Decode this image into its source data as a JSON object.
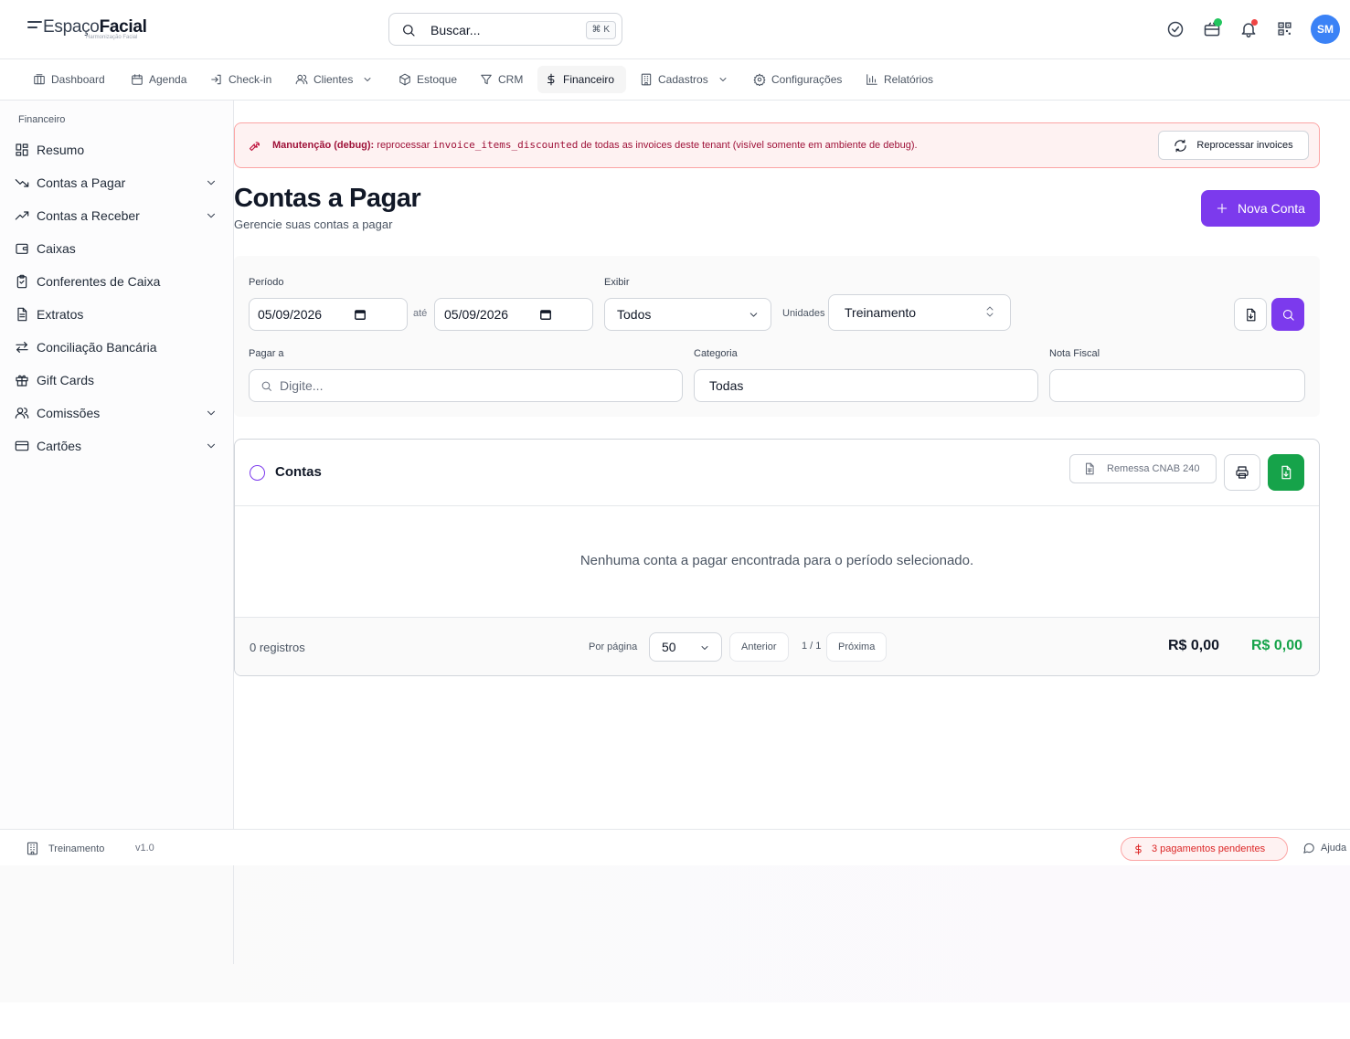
{
  "brand": {
    "name_light": "Espaço",
    "name_bold": "Facial",
    "tagline": "Harmonização Facial"
  },
  "search": {
    "placeholder": "Buscar...",
    "shortcut": "⌘ K"
  },
  "header": {
    "icons": [
      "check-circle-icon",
      "gift-card-icon",
      "bell-icon",
      "qr-code-icon"
    ],
    "avatar_initials": "SM",
    "colors": {
      "avatar": "#3b82f6",
      "status_green": "#22c55e",
      "status_red": "#ef4444"
    }
  },
  "nav": {
    "items": [
      {
        "label": "Dashboard",
        "icon": "dashboard-icon"
      },
      {
        "label": "Agenda",
        "icon": "calendar-icon"
      },
      {
        "label": "Check-in",
        "icon": "login-icon"
      },
      {
        "label": "Clientes",
        "icon": "users-icon",
        "dropdown": true
      },
      {
        "label": "Estoque",
        "icon": "box-icon"
      },
      {
        "label": "CRM",
        "icon": "filter-icon"
      },
      {
        "label": "Financeiro",
        "icon": "dollar-icon",
        "active": true
      },
      {
        "label": "Cadastros",
        "icon": "building-icon",
        "dropdown": true
      },
      {
        "label": "Configurações",
        "icon": "gear-icon"
      },
      {
        "label": "Relatórios",
        "icon": "bar-chart-icon"
      }
    ]
  },
  "sidebar": {
    "title": "Financeiro",
    "items": [
      {
        "label": "Resumo",
        "icon": "grid-icon"
      },
      {
        "label": "Contas a Pagar",
        "icon": "trending-down-icon",
        "expandable": true
      },
      {
        "label": "Contas a Receber",
        "icon": "trending-up-icon",
        "expandable": true
      },
      {
        "label": "Caixas",
        "icon": "wallet-icon"
      },
      {
        "label": "Conferentes de Caixa",
        "icon": "clipboard-check-icon"
      },
      {
        "label": "Extratos",
        "icon": "file-text-icon"
      },
      {
        "label": "Conciliação Bancária",
        "icon": "arrows-swap-icon"
      },
      {
        "label": "Gift Cards",
        "icon": "gift-icon"
      },
      {
        "label": "Comissões",
        "icon": "users-icon",
        "expandable": true
      },
      {
        "label": "Cartões",
        "icon": "credit-card-icon",
        "expandable": true
      }
    ]
  },
  "debug": {
    "title": "Manutenção (debug):",
    "text_before": "reprocessar",
    "code": "invoice_items_discounted",
    "text_after": "de todas as invoices deste tenant (visível somente em ambiente de debug).",
    "button": "Reprocessar invoices"
  },
  "page": {
    "title": "Contas a Pagar",
    "subtitle": "Gerencie suas contas a pagar",
    "new_button": "Nova Conta",
    "accent": "#7c3aed"
  },
  "filters": {
    "period_label": "Período",
    "date_from": "05/09/2026",
    "until_label": "até",
    "date_to": "05/09/2026",
    "show_label": "Exibir",
    "show_value": "Todos",
    "units_label": "Unidades",
    "units_value": "Treinamento",
    "pay_to_label": "Pagar a",
    "pay_to_placeholder": "Digite...",
    "category_label": "Categoria",
    "category_value": "Todas",
    "invoice_label": "Nota Fiscal",
    "invoice_value": ""
  },
  "table": {
    "title": "Contas",
    "cnab_button": "Remessa CNAB 240",
    "empty_message": "Nenhuma conta a pagar encontrada para o período selecionado.",
    "records": "0 registros",
    "per_page_label": "Por página",
    "per_page_value": "50",
    "prev": "Anterior",
    "page_info": "1 / 1",
    "next": "Próxima",
    "total_1": "R$ 0,00",
    "total_2": "R$ 0,00",
    "colors": {
      "excel": "#16a34a",
      "total_green": "#16a34a"
    }
  },
  "footer": {
    "unit": "Treinamento",
    "version": "v1.0",
    "pending": "3 pagamentos pendentes",
    "help": "Ajuda"
  }
}
